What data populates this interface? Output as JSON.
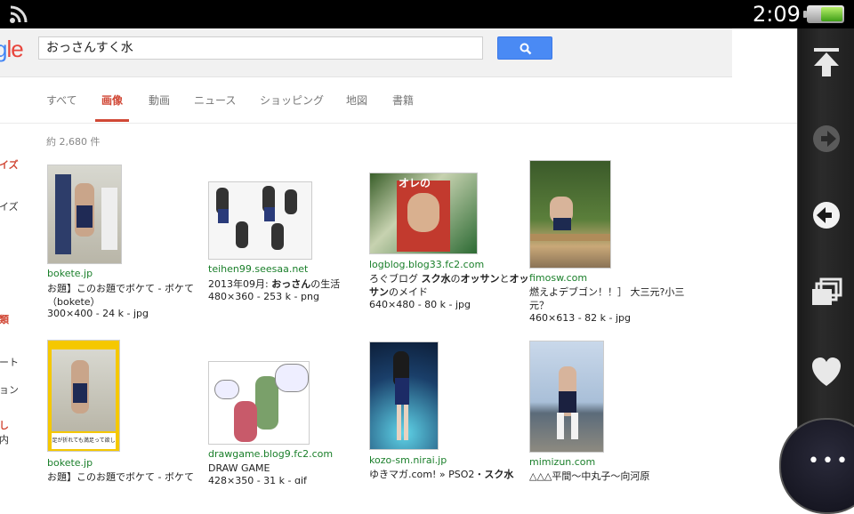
{
  "status": {
    "time": "2:09"
  },
  "logo": {
    "part1": "g",
    "part2": "le"
  },
  "search": {
    "query": "おっさんすく水"
  },
  "tabs": [
    {
      "label": "すべて"
    },
    {
      "label": "画像"
    },
    {
      "label": "動画"
    },
    {
      "label": "ニュース"
    },
    {
      "label": "ショッピング"
    },
    {
      "label": "地図"
    },
    {
      "label": "書籍"
    }
  ],
  "result_count": "約 2,680 件",
  "sidebar_fragments": [
    "イズ",
    "イズ",
    "類",
    "ート",
    "ョン",
    "し",
    "内"
  ],
  "results": [
    {
      "source": "bokete.jp",
      "desc": "お題】このお題でボケて - ボケて（bokete）",
      "meta": "300×400 - 24 k - jpg"
    },
    {
      "source": "teihen99.seesaa.net",
      "desc_pre": "2013年09月: ",
      "desc_bold": "おっさん",
      "desc_post": "の生活",
      "meta": "480×360 - 253 k - png"
    },
    {
      "source": "logblog.blog33.fc2.com",
      "desc_pre": "ろぐブログ ",
      "desc_bold": "スク水",
      "desc_mid": "の",
      "desc_bold2": "オッサン",
      "desc_post": "と",
      "desc_bold3": "オッサン",
      "desc_post2": "のメイド",
      "meta": "640×480 - 80 k - jpg"
    },
    {
      "source": "fimosw.com",
      "desc": "燃えよデブゴン！！］ 大三元?小三元？",
      "meta": "460×613 - 82 k - jpg"
    },
    {
      "source": "bokete.jp",
      "desc": "お題】このお題でボケて - ボケて",
      "meta": ""
    },
    {
      "source": "drawgame.blog9.fc2.com",
      "desc": "DRAW GAME",
      "meta": "428×350 - 31 k - gif"
    },
    {
      "source": "kozo-sm.nirai.jp",
      "desc_pre": "ゆきマガ.com! » PSO2・",
      "desc_bold": "スク水",
      "meta": ""
    },
    {
      "source": "mimizun.com",
      "desc": "△△△平間～中丸子～向河原",
      "meta": ""
    }
  ],
  "thumb_captions": {
    "t3": "オレの",
    "t5": "足が折れても満足って欲しい"
  },
  "colors": {
    "accent_red": "#d14836",
    "link_green": "#1a7f2a",
    "search_blue": "#4a8af4"
  },
  "side_icons": [
    "scroll-top-icon",
    "forward-icon",
    "back-icon",
    "tabs-icon",
    "favorite-icon"
  ]
}
